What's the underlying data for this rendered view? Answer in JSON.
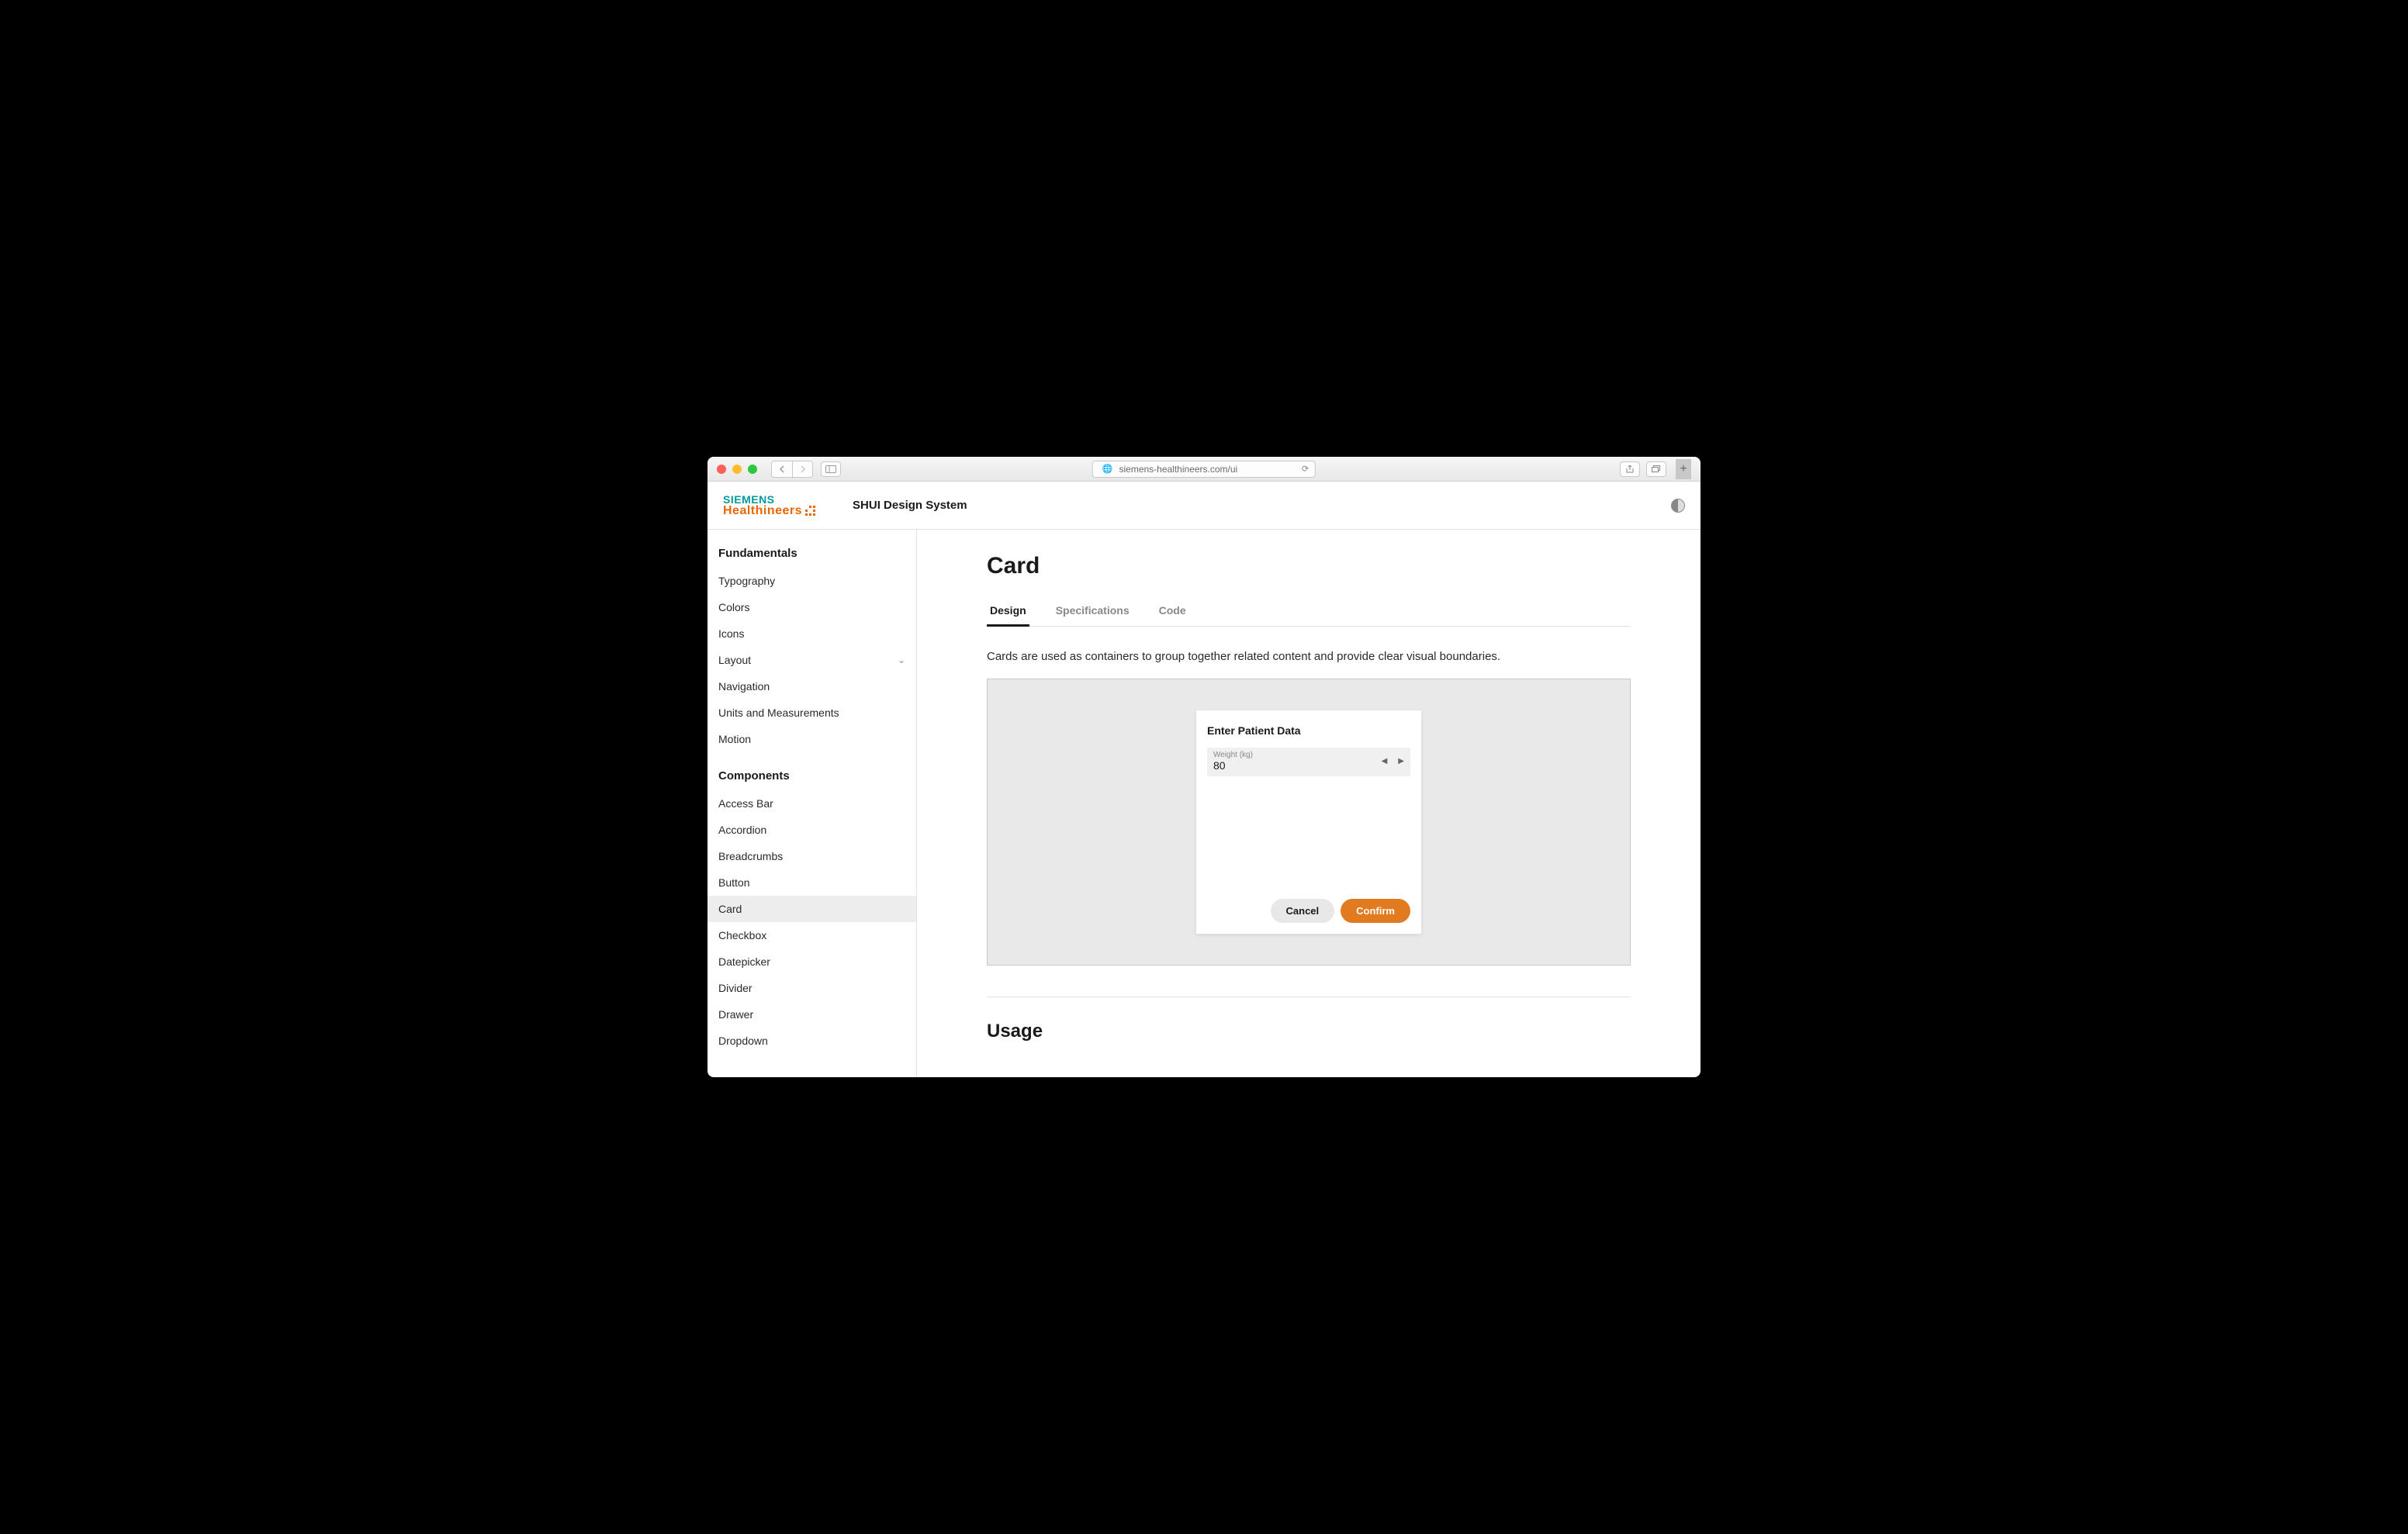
{
  "browser": {
    "url": "siemens-healthineers.com/ui"
  },
  "header": {
    "logo_top": "SIEMENS",
    "logo_bottom": "Healthineers",
    "app_title": "SHUI Design System"
  },
  "sidebar": {
    "sections": [
      {
        "title": "Fundamentals",
        "items": [
          {
            "label": "Typography",
            "expandable": false
          },
          {
            "label": "Colors",
            "expandable": false
          },
          {
            "label": "Icons",
            "expandable": false
          },
          {
            "label": "Layout",
            "expandable": true
          },
          {
            "label": "Navigation",
            "expandable": false
          },
          {
            "label": "Units and Measurements",
            "expandable": false
          },
          {
            "label": "Motion",
            "expandable": false
          }
        ]
      },
      {
        "title": "Components",
        "items": [
          {
            "label": "Access Bar"
          },
          {
            "label": "Accordion"
          },
          {
            "label": "Breadcrumbs"
          },
          {
            "label": "Button"
          },
          {
            "label": "Card",
            "active": true
          },
          {
            "label": "Checkbox"
          },
          {
            "label": "Datepicker"
          },
          {
            "label": "Divider"
          },
          {
            "label": "Drawer"
          },
          {
            "label": "Dropdown"
          }
        ]
      }
    ]
  },
  "main": {
    "title": "Card",
    "tabs": [
      {
        "label": "Design",
        "active": true
      },
      {
        "label": "Specifications"
      },
      {
        "label": "Code"
      }
    ],
    "description": "Cards are used as containers to group together related content and provide clear visual boundaries.",
    "example": {
      "card_title": "Enter Patient Data",
      "stepper_label": "Weight (kg)",
      "stepper_value": "80",
      "cancel_label": "Cancel",
      "confirm_label": "Confirm"
    },
    "usage_heading": "Usage"
  },
  "colors": {
    "primary": "#e27a1f",
    "teal": "#009999"
  }
}
